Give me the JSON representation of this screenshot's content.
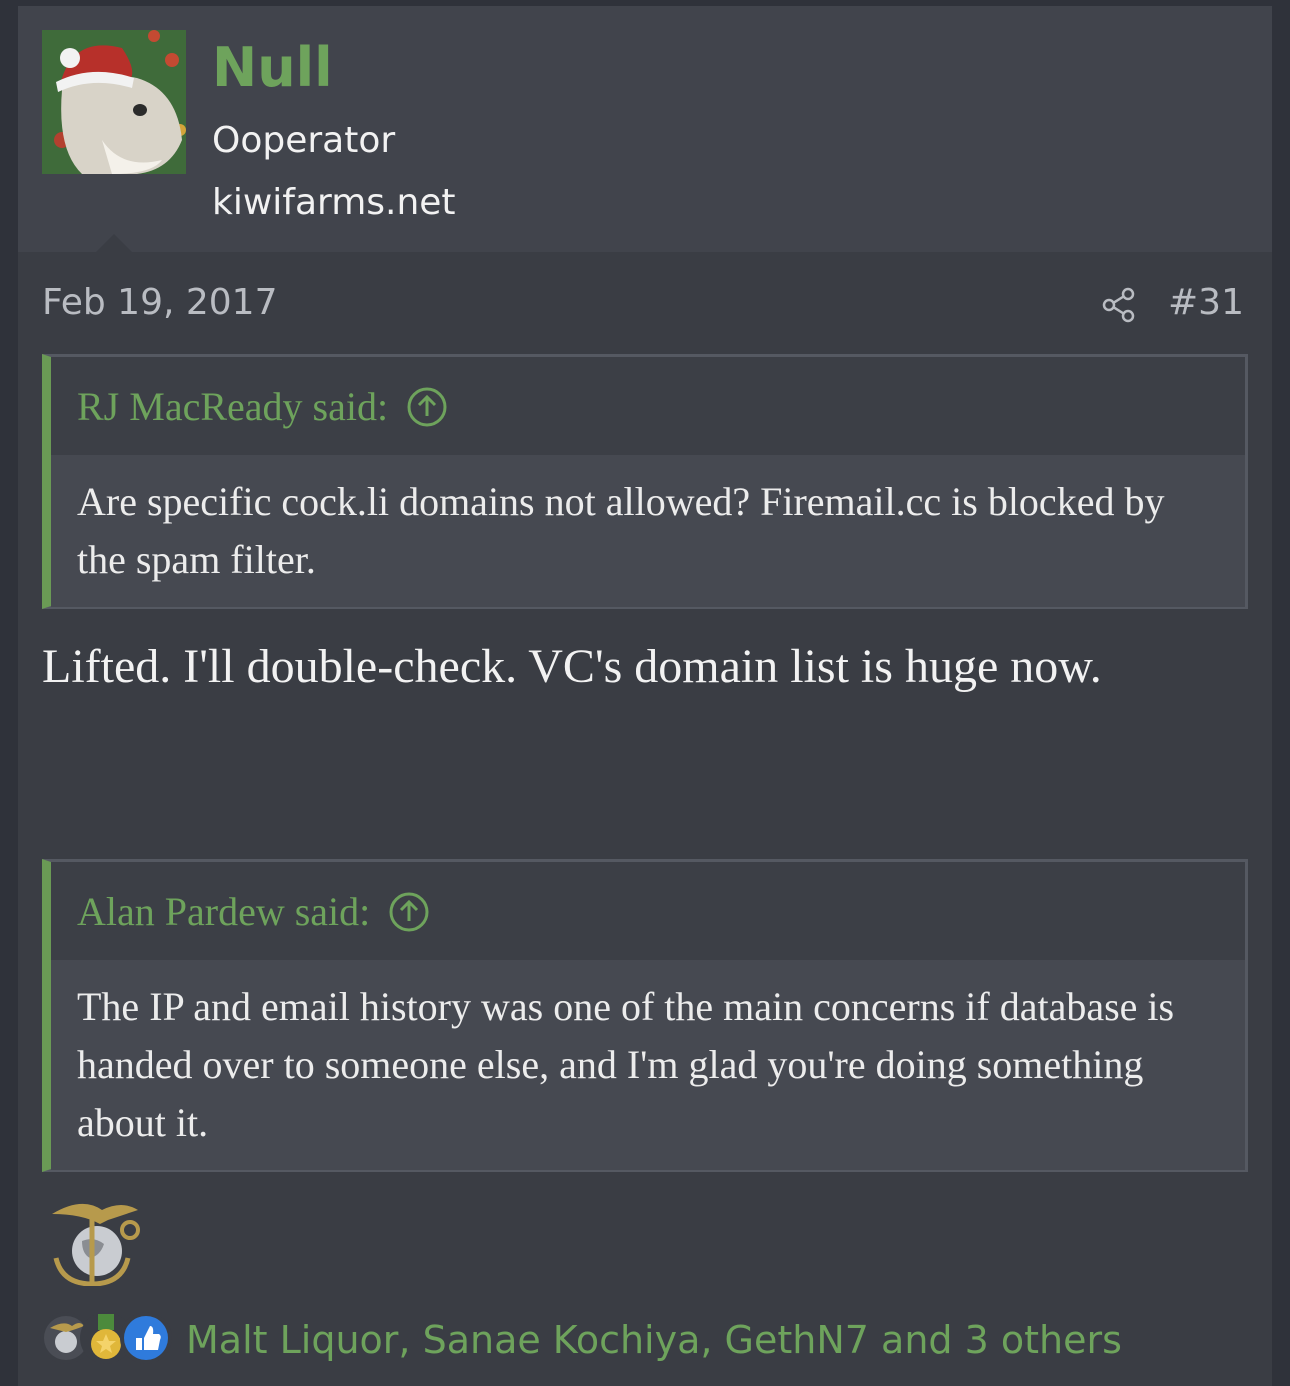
{
  "post": {
    "user": {
      "name": "Null",
      "title": "Ooperator",
      "banner": "kiwifarms.net"
    },
    "date": "Feb 19, 2017",
    "number": "#31",
    "quotes": [
      {
        "attribution": "RJ MacReady said:",
        "body": "Are specific cock.li domains not allowed? Firemail.cc is blocked by the spam filter."
      },
      {
        "attribution": "Alan Pardew said:",
        "body": "The IP and email history was one of the main concerns if database is handed over to someone else, and I'm glad you're doing something about it."
      }
    ],
    "reply_text": "Lifted. I'll double-check. VC's domain list is huge now.",
    "reactions": {
      "icons": [
        "emblem-icon",
        "medal-icon",
        "like-icon"
      ],
      "summary": "Malt Liquor, Sanae Kochiya, GethN7 and 3 others"
    }
  },
  "colors": {
    "background": "#3a3d44",
    "accent_green": "#6ea35c",
    "quote_bar": "#6a9a55"
  }
}
